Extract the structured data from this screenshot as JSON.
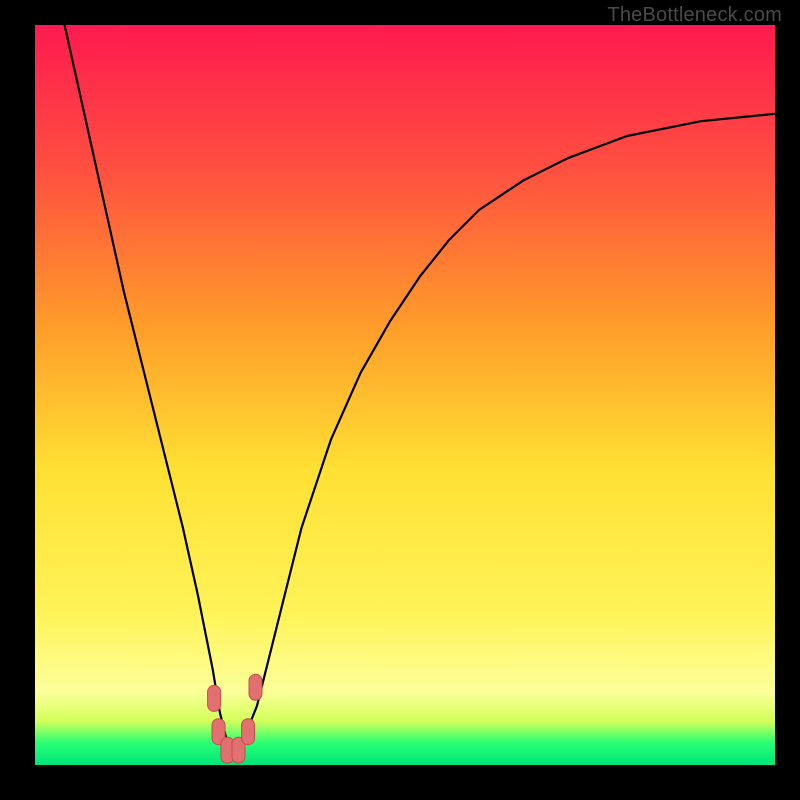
{
  "watermark": "TheBottleneck.com",
  "chart_data": {
    "type": "line",
    "title": "",
    "xlabel": "",
    "ylabel": "",
    "xlim": [
      0,
      100
    ],
    "ylim": [
      0,
      100
    ],
    "series": [
      {
        "name": "bottleneck-curve",
        "x": [
          4,
          6,
          8,
          10,
          12,
          14,
          16,
          18,
          20,
          22,
          24,
          25,
          26,
          27,
          28,
          30,
          32,
          34,
          36,
          38,
          40,
          44,
          48,
          52,
          56,
          60,
          66,
          72,
          80,
          90,
          100
        ],
        "y": [
          100,
          91,
          82,
          73,
          64,
          56,
          48,
          40,
          32,
          23,
          13,
          7,
          3,
          2,
          3,
          8,
          16,
          24,
          32,
          38,
          44,
          53,
          60,
          66,
          71,
          75,
          79,
          82,
          85,
          87,
          88
        ]
      }
    ],
    "markers": [
      {
        "name": "fit-badge-left-top",
        "x": 24.2,
        "y": 9.0
      },
      {
        "name": "fit-badge-left-bottom",
        "x": 24.8,
        "y": 4.5
      },
      {
        "name": "fit-badge-center-1",
        "x": 26.0,
        "y": 2.0
      },
      {
        "name": "fit-badge-center-2",
        "x": 27.5,
        "y": 2.0
      },
      {
        "name": "fit-badge-right-bottom",
        "x": 28.8,
        "y": 4.5
      },
      {
        "name": "fit-badge-right-top",
        "x": 29.8,
        "y": 10.5
      }
    ]
  },
  "colors": {
    "curve": "#000000",
    "marker_fill": "#e27070",
    "marker_stroke": "#c24d4d"
  }
}
